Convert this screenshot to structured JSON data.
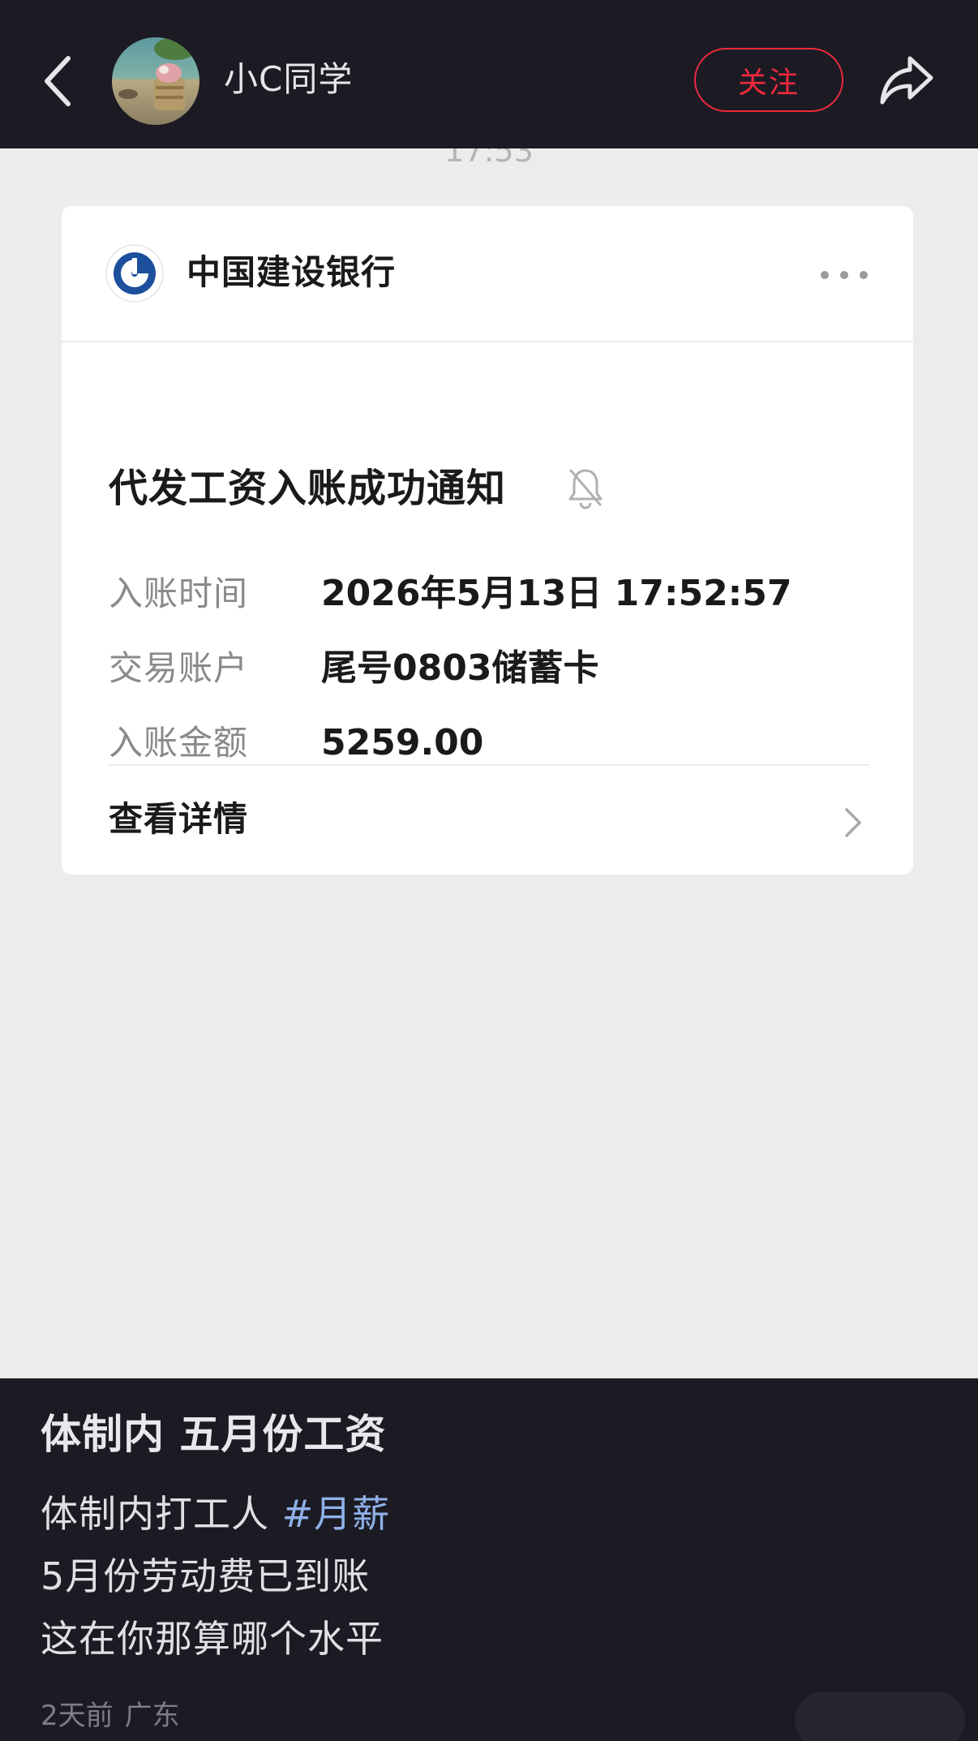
{
  "header": {
    "username": "小C同学",
    "follow_label": "关注"
  },
  "screenshot": {
    "message_time": "17:53",
    "card": {
      "bank_name": "中国建设银行",
      "notice_title": "代发工资入账成功通知",
      "rows": [
        {
          "label": "入账时间",
          "value": "2026年5月13日 17:52:57"
        },
        {
          "label": "交易账户",
          "value": "尾号0803储蓄卡"
        },
        {
          "label": "入账金额",
          "value": "5259.00"
        }
      ],
      "detail_label": "查看详情"
    }
  },
  "post": {
    "title": "体制内 五月份工资",
    "line1_text": "体制内打工人 ",
    "hashtag": "#月薪",
    "line2": "5月份劳动费已到账",
    "line3": "这在你那算哪个水平",
    "time_ago": "2天前",
    "location": "广东"
  },
  "colors": {
    "accent_red": "#f0293e",
    "bank_blue": "#1c4f9c",
    "hashtag_blue": "#8fb1e8",
    "dark_bg": "#1c1b24"
  },
  "icons": {
    "back": "chevron-left-icon",
    "share": "share-arrow-icon",
    "more": "more-dots-icon",
    "bell": "bell-off-icon",
    "chevron": "chevron-right-icon"
  }
}
